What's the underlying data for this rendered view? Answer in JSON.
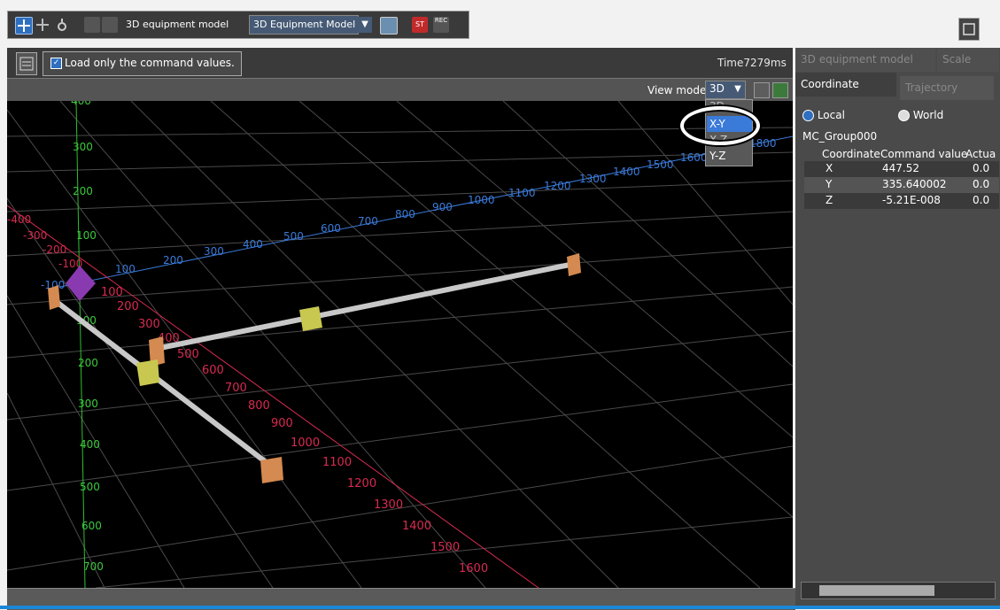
{
  "toolbar": {
    "model_label": "3D equipment model",
    "model_select": "3D Equipment Model",
    "dropdown_arrow": "▼",
    "stop_label": "ST",
    "rec_label": "REC"
  },
  "command": {
    "checkbox_checked": true,
    "label": "Load only the command values."
  },
  "time": "Time7279ms",
  "view": {
    "mode_label": "View mode",
    "mode_value": "3D",
    "options": [
      "3D",
      "X-Y",
      "X-Z",
      "Y-Z"
    ],
    "highlighted_option": "X-Y"
  },
  "axis_labels": {
    "y_axis": [
      "100",
      "200",
      "300",
      "400",
      "500",
      "600",
      "700",
      "800",
      "900",
      "1000",
      "1100",
      "1200",
      "1300",
      "1400",
      "1500",
      "1600",
      "1700",
      "1800"
    ],
    "x_axis": [
      "100",
      "200",
      "300",
      "400",
      "500",
      "600",
      "700",
      "800",
      "900",
      "1000",
      "1100",
      "1200",
      "1300",
      "1400",
      "1500",
      "1600"
    ],
    "z_axis": [
      "400",
      "300",
      "200",
      "100",
      "100",
      "200",
      "300",
      "400",
      "500",
      "600",
      "700"
    ],
    "neg_labels": [
      "-400",
      "-300",
      "-200",
      "-100",
      "-100"
    ]
  },
  "panel": {
    "tabs_top": [
      "3D equipment model",
      "Scale"
    ],
    "tabs_second": [
      "Coordinate",
      "Trajectory"
    ],
    "radio_local": "Local",
    "radio_world": "World",
    "group": "MC_Group000",
    "table_headers": [
      "Coordinate",
      "Command value",
      "Actua"
    ],
    "rows": [
      {
        "axis": "X",
        "command": "447.52",
        "actual": "0.0"
      },
      {
        "axis": "Y",
        "command": "335.640002",
        "actual": "0.0"
      },
      {
        "axis": "Z",
        "command": "-5.21E-008",
        "actual": "0.0"
      }
    ]
  },
  "colors": {
    "accent": "#1a88d8",
    "y_axis": "#3a7ad8",
    "x_axis": "#d82a50",
    "z_axis": "#3cc83c"
  }
}
